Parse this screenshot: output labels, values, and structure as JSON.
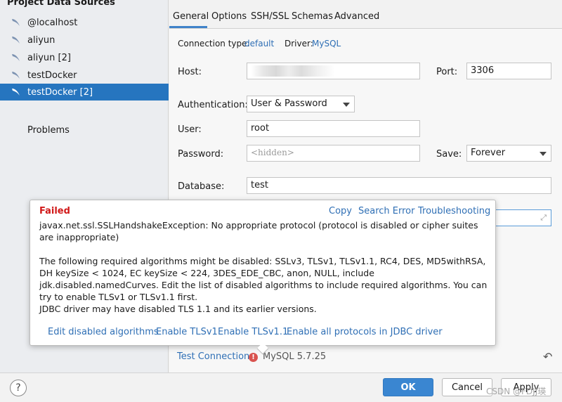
{
  "sidebar": {
    "title": "Project Data Sources",
    "items": [
      {
        "label": "@localhost"
      },
      {
        "label": "aliyun"
      },
      {
        "label": "aliyun [2]"
      },
      {
        "label": "testDocker"
      },
      {
        "label": "testDocker [2]",
        "selected": true
      }
    ],
    "problems_label": "Problems"
  },
  "tabs": [
    "General",
    "Options",
    "SSH/SSL",
    "Schemas",
    "Advanced"
  ],
  "general": {
    "connection_type_label": "Connection type:",
    "connection_type_value": "default",
    "driver_label": "Driver:",
    "driver_value": "MySQL",
    "host_label": "Host:",
    "host_value": "",
    "port_label": "Port:",
    "port_value": "3306",
    "auth_label": "Authentication:",
    "auth_value": "User & Password",
    "user_label": "User:",
    "user_value": "root",
    "password_label": "Password:",
    "password_placeholder": "<hidden>",
    "save_label": "Save:",
    "save_value": "Forever",
    "database_label": "Database:",
    "database_value": "test"
  },
  "error_popup": {
    "status": "Failed",
    "links": [
      "Copy",
      "Search Error",
      "Troubleshooting"
    ],
    "message1": "javax.net.ssl.SSLHandshakeException: No appropriate protocol (protocol is disabled or cipher suites are inappropriate)",
    "message2": "The following required algorithms might be disabled: SSLv3, TLSv1, TLSv1.1, RC4, DES, MD5withRSA, DH keySize < 1024, EC keySize < 224, 3DES_EDE_CBC, anon, NULL, include jdk.disabled.namedCurves. Edit the list of disabled algorithms to include required algorithms. You can try to enable TLSv1 or TLSv1.1 first.",
    "message3": "JDBC driver may have disabled TLS 1.1 and its earlier versions.",
    "actions": [
      "Edit disabled algorithms",
      "Enable TLSv1",
      "Enable TLSv1.1",
      "Enable all protocols in JDBC driver"
    ]
  },
  "test_connection": {
    "label": "Test Connection",
    "result": "MySQL 5.7.25"
  },
  "buttons": {
    "help": "?",
    "ok": "OK",
    "cancel": "Cancel",
    "apply": "Apply"
  },
  "watermark": "CSDN @FDJJ瑛",
  "colors": {
    "selection": "#2675bf",
    "link": "#2f6fb5",
    "error": "#d11a1a",
    "primary_button": "#3a86d1"
  }
}
